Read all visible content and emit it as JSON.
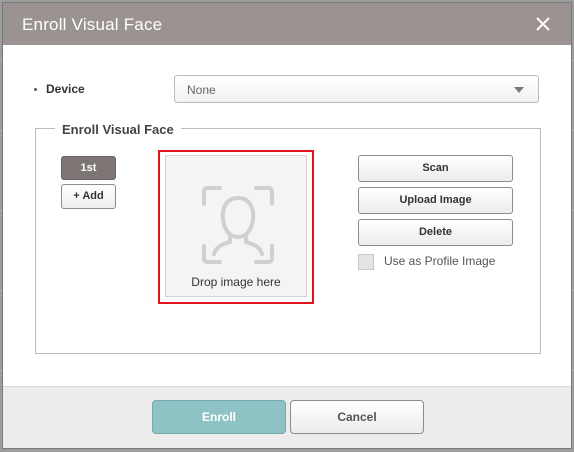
{
  "dialog": {
    "title": "Enroll Visual Face",
    "close_icon": "close-icon"
  },
  "device": {
    "label": "Device",
    "selected": "None"
  },
  "enroll_section": {
    "legend": "Enroll Visual Face",
    "slot_label": "1st",
    "add_label": "+ Add",
    "drop_text": "Drop image here",
    "face_icon": "face-scan-icon",
    "scan_label": "Scan",
    "upload_label": "Upload Image",
    "delete_label": "Delete",
    "profile_checkbox_label": "Use as Profile Image",
    "profile_checked": false
  },
  "footer": {
    "enroll_label": "Enroll",
    "cancel_label": "Cancel"
  },
  "colors": {
    "titlebar": "#9b9392",
    "accent": "#8fc2c5",
    "highlight_border": "#e0141b",
    "slot_active": "#7d7574"
  }
}
